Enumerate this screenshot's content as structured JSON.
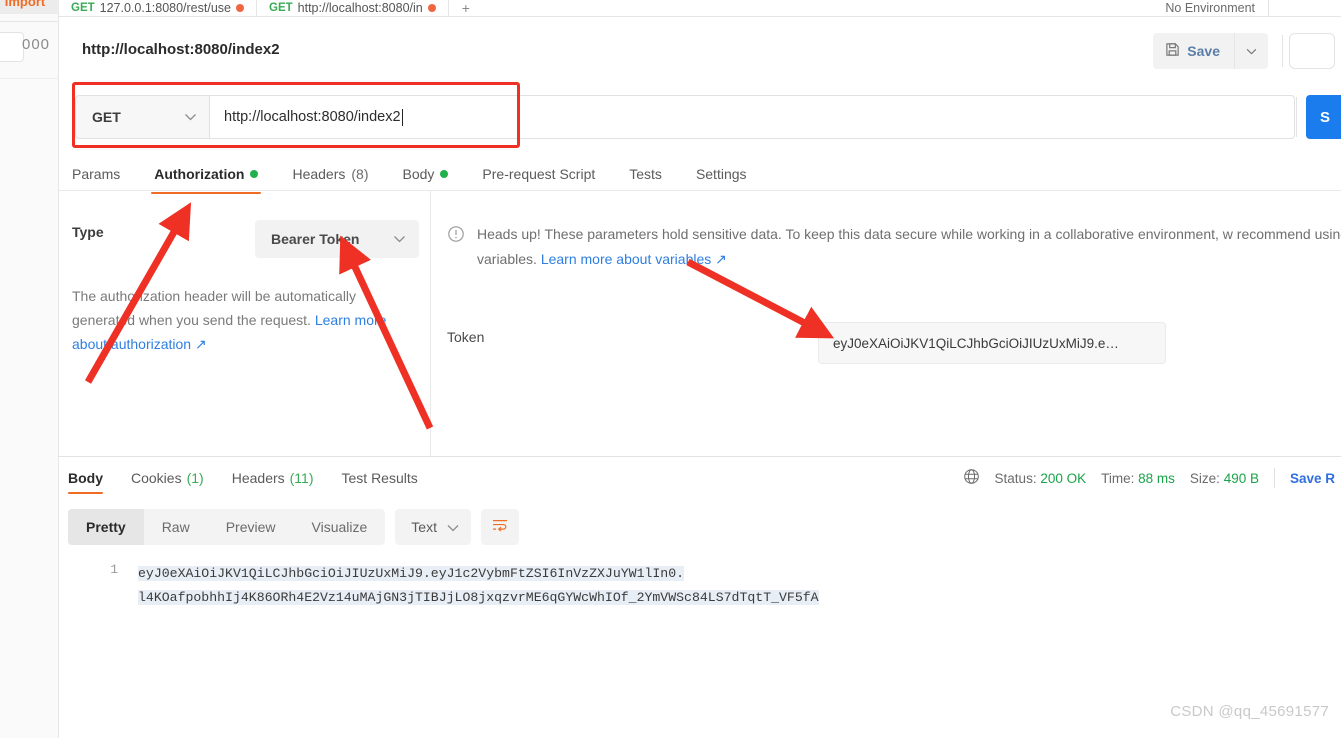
{
  "app": {
    "import_label": "Import",
    "overflow_menu": "000",
    "environment_label": "No Environment"
  },
  "tabstrip": {
    "tabs": [
      {
        "method": "GET",
        "name": "127.0.0.1:8080/rest/use",
        "dirty": true,
        "active": false
      },
      {
        "method": "GET",
        "name": "http://localhost:8080/in",
        "dirty": true,
        "active": true
      }
    ],
    "new_tab_label": "+"
  },
  "header": {
    "breadcrumb": "http://localhost:8080/index2",
    "save_label": "Save",
    "save_icon": "floppy-disk-icon",
    "save_caret_icon": "chevron-down-icon"
  },
  "request": {
    "method": "GET",
    "method_caret_icon": "chevron-down-icon",
    "url": "http://localhost:8080/index2",
    "send_label": "S",
    "tabs": [
      {
        "label": "Params",
        "dot": false,
        "count": "",
        "active": false
      },
      {
        "label": "Authorization",
        "dot": true,
        "count": "",
        "active": true
      },
      {
        "label": "Headers",
        "dot": false,
        "count": "(8)",
        "active": false
      },
      {
        "label": "Body",
        "dot": true,
        "count": "",
        "active": false
      },
      {
        "label": "Pre-request Script",
        "dot": false,
        "count": "",
        "active": false
      },
      {
        "label": "Tests",
        "dot": false,
        "count": "",
        "active": false
      },
      {
        "label": "Settings",
        "dot": false,
        "count": "",
        "active": false
      }
    ]
  },
  "auth": {
    "type_label": "Type",
    "type_value": "Bearer Token",
    "type_caret_icon": "chevron-down-icon",
    "description": "The authorization header will be automatically generated when you send the request.",
    "learn_more": "Learn more about authorization ↗",
    "headsup_icon": "alert-circle-icon",
    "headsup_text": "Heads up! These parameters hold sensitive data. To keep this data secure while working in a collaborative environment, w recommend using variables.",
    "headsup_link": "Learn more about variables ↗",
    "token_label": "Token",
    "token_value": "eyJ0eXAiOiJKV1QiLCJhbGciOiJIUzUxMiJ9.e…"
  },
  "response": {
    "tabs": [
      {
        "label": "Body",
        "count": "",
        "active": true
      },
      {
        "label": "Cookies",
        "count": "(1)",
        "active": false
      },
      {
        "label": "Headers",
        "count": "(11)",
        "active": false
      },
      {
        "label": "Test Results",
        "count": "",
        "active": false
      }
    ],
    "globe_icon": "globe-icon",
    "status_label": "Status:",
    "status_value": "200 OK",
    "time_label": "Time:",
    "time_value": "88 ms",
    "size_label": "Size:",
    "size_value": "490 B",
    "save_response_label": "Save R",
    "view_modes": [
      {
        "label": "Pretty",
        "active": true
      },
      {
        "label": "Raw",
        "active": false
      },
      {
        "label": "Preview",
        "active": false
      },
      {
        "label": "Visualize",
        "active": false
      }
    ],
    "format_value": "Text",
    "format_caret_icon": "chevron-down-icon",
    "wrap_icon": "word-wrap-icon",
    "line_number": "1",
    "body_line_1": "eyJ0eXAiOiJKV1QiLCJhbGciOiJIUzUxMiJ9.eyJ1c2VybmFtZSI6InVzZXJuYW1lIn0.",
    "body_line_2": "l4KOafpobhhIj4K86ORh4E2Vz14uMAjGN3jTIBJjLO8jxqzvrME6qGYWcWhIOf_2YmVWSc84LS7dTqtT_VF5fA"
  },
  "watermark": "CSDN @qq_45691577",
  "colors": {
    "accent_orange": "#ef6c24",
    "send_blue": "#1b7ced",
    "success_green": "#1aa34a",
    "annotation_red": "#ee3124"
  }
}
